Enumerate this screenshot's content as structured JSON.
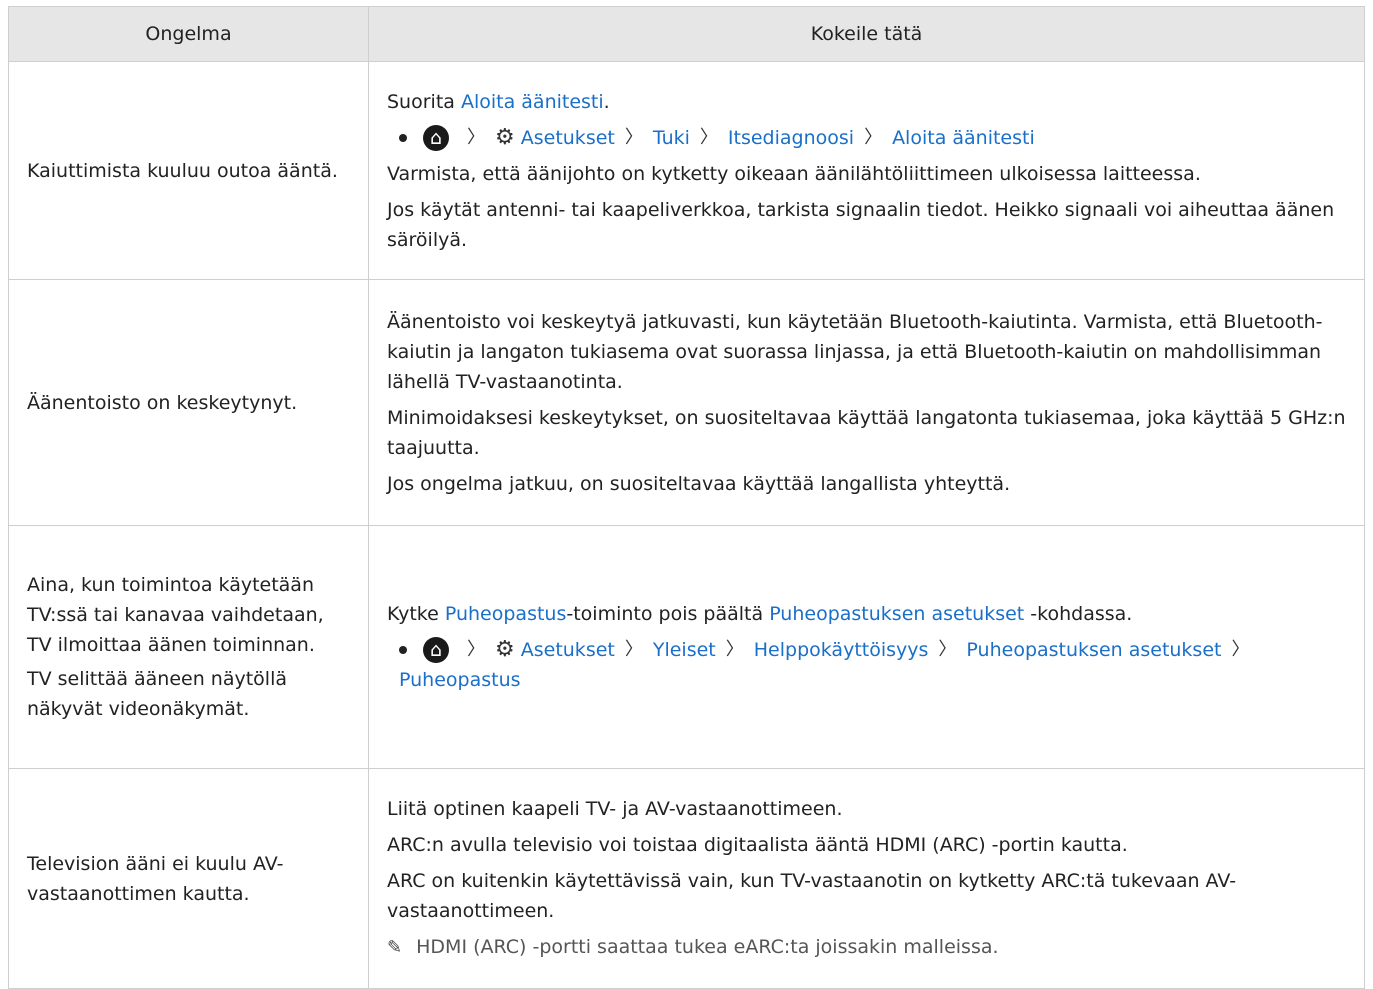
{
  "header": {
    "col_problem": "Ongelma",
    "col_solution": "Kokeile tätä"
  },
  "rows": [
    {
      "problem": "Kaiuttimista kuuluu outoa ääntä.",
      "pre": "Suorita",
      "link": "Aloita äänitesti",
      "post": ".",
      "path": [
        "Asetukset",
        "Tuki",
        "Itsediagnoosi",
        "Aloita äänitesti"
      ],
      "p2": "Varmista, että äänijohto on kytketty oikeaan äänilähtöliittimeen ulkoisessa laitteessa.",
      "p3": "Jos käytät antenni- tai kaapeliverkkoa, tarkista signaalin tiedot. Heikko signaali voi aiheuttaa äänen säröilyä."
    },
    {
      "problem": "Äänentoisto on keskeytynyt.",
      "p1": "Äänentoisto voi keskeytyä jatkuvasti, kun käytetään Bluetooth-kaiutinta. Varmista, että Bluetooth-kaiutin ja langaton tukiasema ovat suorassa linjassa, ja että Bluetooth-kaiutin on mahdollisimman lähellä TV-vastaanotinta.",
      "p2": "Minimoidaksesi keskeytykset, on suositeltavaa käyttää langatonta tukiasemaa, joka käyttää 5 GHz:n taajuutta.",
      "p3": "Jos ongelma jatkuu, on suositeltavaa käyttää langallista yhteyttä."
    },
    {
      "problem_a": "Aina, kun toimintoa käytetään TV:ssä tai kanavaa vaihdetaan, TV ilmoittaa äänen toiminnan.",
      "problem_b": "TV selittää ääneen näytöllä näkyvät videonäkymät.",
      "pre": "Kytke",
      "link1": "Puheopastus",
      "mid": "-toiminto pois päältä",
      "link2": "Puheopastuksen asetukset",
      "post": "-kohdassa.",
      "path": [
        "Asetukset",
        "Yleiset",
        "Helppokäyttöisyys",
        "Puheopastuksen asetukset",
        "Puheopastus"
      ]
    },
    {
      "problem": "Television ääni ei kuulu AV-vastaanottimen kautta.",
      "p1": "Liitä optinen kaapeli TV- ja AV-vastaanottimeen.",
      "p2": "ARC:n avulla televisio voi toistaa digitaalista ääntä HDMI (ARC) -portin kautta.",
      "p3": "ARC on kuitenkin käytettävissä vain, kun TV-vastaanotin on kytketty ARC:tä tukevaan AV-vastaanottimeen.",
      "note": "HDMI (ARC) -portti saattaa tukea eARC:ta joissakin malleissa."
    }
  ]
}
